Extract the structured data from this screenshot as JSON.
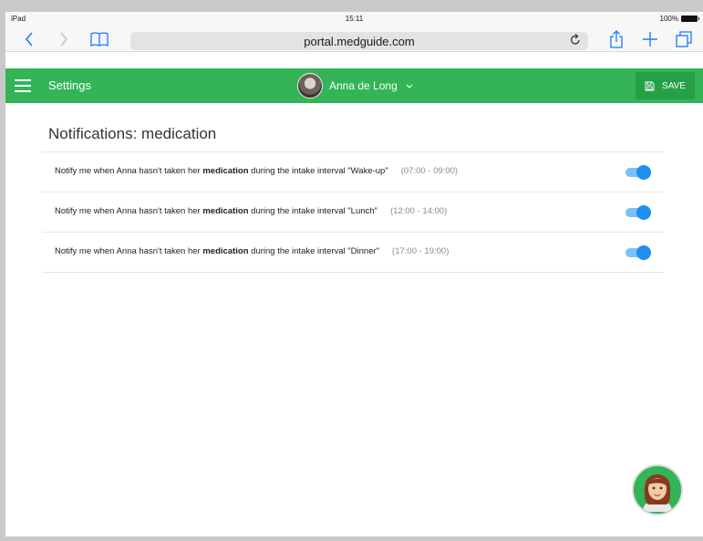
{
  "status_bar": {
    "device": "iPad",
    "time": "15:11",
    "battery": "100%"
  },
  "browser": {
    "url": "portal.medguide.com",
    "icons": [
      "back-arrow-icon",
      "forward-arrow-icon",
      "bookmarks-icon",
      "reload-icon",
      "share-icon",
      "new-tab-icon",
      "tabs-icon"
    ]
  },
  "header": {
    "title": "Settings",
    "user_name": "Anna de Long",
    "save_label": "SAVE",
    "accent_color": "#33b457"
  },
  "page": {
    "heading": "Notifications: medication",
    "rules": [
      {
        "prefix": "Notify me when Anna hasn't taken her ",
        "keyword": "medication",
        "suffix": " during the intake interval \"Wake-up\"",
        "time": "(07:00 - 09:00)",
        "enabled": true
      },
      {
        "prefix": "Notify me when Anna hasn't taken her ",
        "keyword": "medication",
        "suffix": " during the intake interval \"Lunch\"",
        "time": "(12:00 - 14:00)",
        "enabled": true
      },
      {
        "prefix": "Notify me when Anna hasn't taken her ",
        "keyword": "medication",
        "suffix": " during the intake interval \"Dinner\"",
        "time": "(17:00 - 19:00)",
        "enabled": true
      }
    ],
    "toggle_color": "#1e8ef0"
  }
}
